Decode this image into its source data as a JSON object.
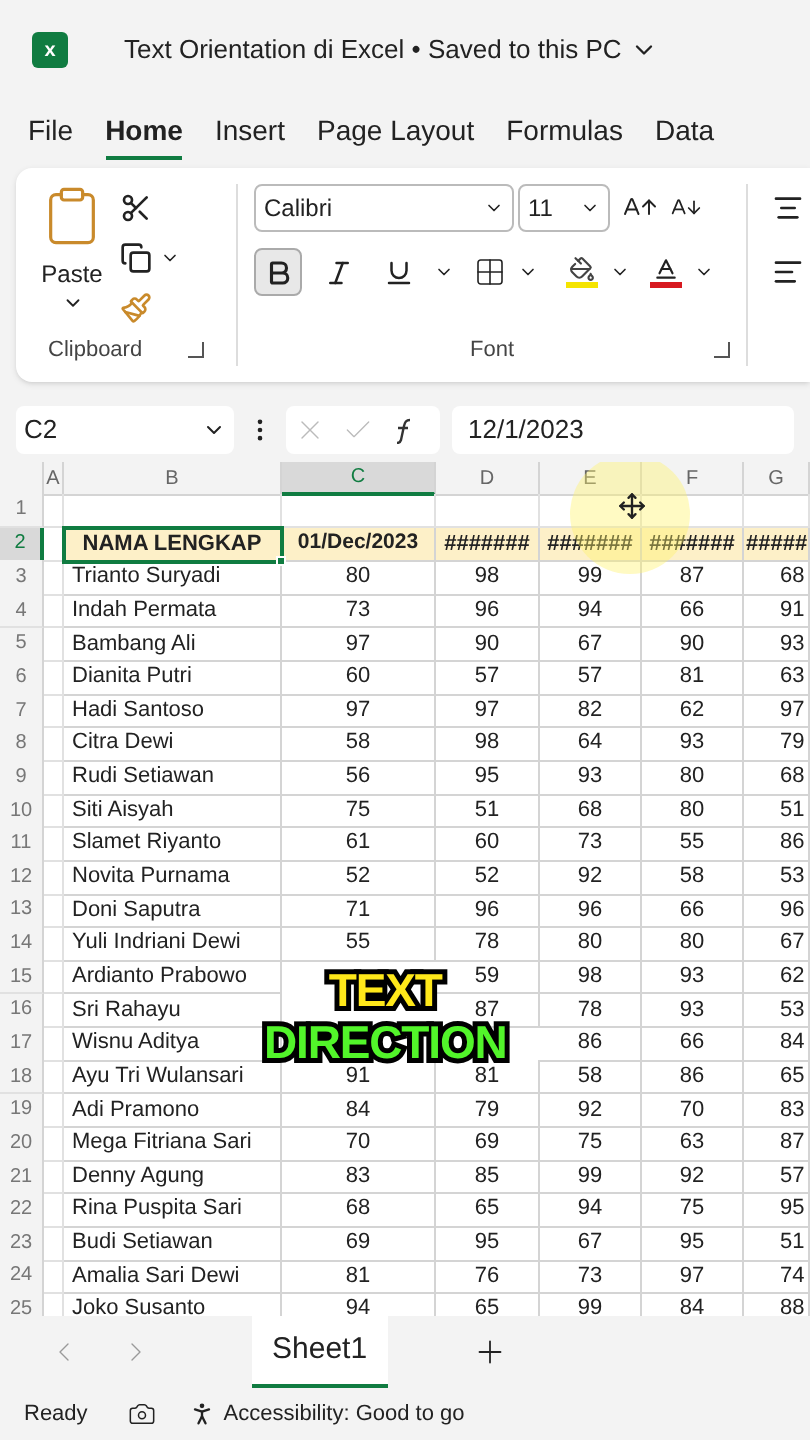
{
  "title_bar": {
    "logo_letter": "x",
    "title": "Text Orientation di Excel • Saved to this PC"
  },
  "tabs": [
    {
      "label": "File",
      "selected": false
    },
    {
      "label": "Home",
      "selected": true
    },
    {
      "label": "Insert",
      "selected": false
    },
    {
      "label": "Page Layout",
      "selected": false
    },
    {
      "label": "Formulas",
      "selected": false
    },
    {
      "label": "Data",
      "selected": false
    }
  ],
  "ribbon": {
    "clipboard": {
      "paste_label": "Paste",
      "group_label": "Clipboard"
    },
    "font": {
      "font_name": "Calibri",
      "font_size": "11",
      "group_label": "Font",
      "style_buttons": [
        {
          "kind": "bold",
          "selected": true
        },
        {
          "kind": "italic",
          "selected": false
        },
        {
          "kind": "underline",
          "selected": false
        }
      ]
    }
  },
  "formula_bar": {
    "name_box": "C2",
    "formula": "12/1/2023"
  },
  "sheet": {
    "columns": [
      {
        "label": "A",
        "selected": false
      },
      {
        "label": "B",
        "selected": false
      },
      {
        "label": "C",
        "selected": true
      },
      {
        "label": "D",
        "selected": false
      },
      {
        "label": "E",
        "selected": false
      },
      {
        "label": "F",
        "selected": false
      },
      {
        "label": "G",
        "selected": false
      }
    ],
    "rows": [
      {
        "number": "1",
        "selected": false,
        "kind": "empty"
      },
      {
        "number": "2",
        "selected": true,
        "kind": "header",
        "cells": [
          "NAMA LENGKAP",
          "01/Dec/2023",
          "#######",
          "#######",
          "#######",
          "#####"
        ]
      },
      {
        "number": "3",
        "selected": false,
        "kind": "data",
        "cells": [
          "Trianto Suryadi",
          "80",
          "98",
          "99",
          "87",
          "68"
        ]
      },
      {
        "number": "4",
        "selected": false,
        "kind": "data",
        "cells": [
          "Indah Permata",
          "73",
          "96",
          "94",
          "66",
          "91"
        ]
      },
      {
        "number": "5",
        "selected": false,
        "kind": "data",
        "cells": [
          "Bambang Ali",
          "97",
          "90",
          "67",
          "90",
          "93"
        ]
      },
      {
        "number": "6",
        "selected": false,
        "kind": "data",
        "cells": [
          "Dianita Putri",
          "60",
          "57",
          "57",
          "81",
          "63"
        ]
      },
      {
        "number": "7",
        "selected": false,
        "kind": "data",
        "cells": [
          "Hadi Santoso",
          "97",
          "97",
          "82",
          "62",
          "97"
        ]
      },
      {
        "number": "8",
        "selected": false,
        "kind": "data",
        "cells": [
          "Citra Dewi",
          "58",
          "98",
          "64",
          "93",
          "79"
        ]
      },
      {
        "number": "9",
        "selected": false,
        "kind": "data",
        "cells": [
          "Rudi Setiawan",
          "56",
          "95",
          "93",
          "80",
          "68"
        ]
      },
      {
        "number": "10",
        "selected": false,
        "kind": "data",
        "cells": [
          "Siti Aisyah",
          "75",
          "51",
          "68",
          "80",
          "51"
        ]
      },
      {
        "number": "11",
        "selected": false,
        "kind": "data",
        "cells": [
          "Slamet Riyanto",
          "61",
          "60",
          "73",
          "55",
          "86"
        ]
      },
      {
        "number": "12",
        "selected": false,
        "kind": "data",
        "cells": [
          "Novita Purnama",
          "52",
          "52",
          "92",
          "58",
          "53"
        ]
      },
      {
        "number": "13",
        "selected": false,
        "kind": "data",
        "cells": [
          "Doni Saputra",
          "71",
          "96",
          "96",
          "66",
          "96"
        ]
      },
      {
        "number": "14",
        "selected": false,
        "kind": "data",
        "cells": [
          "Yuli Indriani Dewi",
          "55",
          "78",
          "80",
          "80",
          "67"
        ]
      },
      {
        "number": "15",
        "selected": false,
        "kind": "data",
        "cells": [
          "Ardianto Prabowo",
          null,
          "59",
          "98",
          "93",
          "62"
        ]
      },
      {
        "number": "16",
        "selected": false,
        "kind": "data",
        "cells": [
          "Sri Rahayu",
          null,
          "87",
          "78",
          "93",
          "53"
        ]
      },
      {
        "number": "17",
        "selected": false,
        "kind": "data",
        "cells": [
          "Wisnu Aditya",
          null,
          null,
          "86",
          "66",
          "84"
        ]
      },
      {
        "number": "18",
        "selected": false,
        "kind": "data",
        "cells": [
          "Ayu Tri Wulansari",
          "91",
          "81",
          "58",
          "86",
          "65"
        ]
      },
      {
        "number": "19",
        "selected": false,
        "kind": "data",
        "cells": [
          "Adi Pramono",
          "84",
          "79",
          "92",
          "70",
          "83"
        ]
      },
      {
        "number": "20",
        "selected": false,
        "kind": "data",
        "cells": [
          "Mega Fitriana Sari",
          "70",
          "69",
          "75",
          "63",
          "87"
        ]
      },
      {
        "number": "21",
        "selected": false,
        "kind": "data",
        "cells": [
          "Denny Agung",
          "83",
          "85",
          "99",
          "92",
          "57"
        ]
      },
      {
        "number": "22",
        "selected": false,
        "kind": "data",
        "cells": [
          "Rina Puspita Sari",
          "68",
          "65",
          "94",
          "75",
          "95"
        ]
      },
      {
        "number": "23",
        "selected": false,
        "kind": "data",
        "cells": [
          "Budi Setiawan",
          "69",
          "95",
          "67",
          "95",
          "51"
        ]
      },
      {
        "number": "24",
        "selected": false,
        "kind": "data",
        "cells": [
          "Amalia Sari Dewi",
          "81",
          "76",
          "73",
          "97",
          "74"
        ]
      },
      {
        "number": "25",
        "selected": false,
        "kind": "data",
        "cells": [
          "Joko Susanto",
          "94",
          "65",
          "99",
          "84",
          "88"
        ]
      }
    ]
  },
  "caption": [
    {
      "text": "TEXT",
      "color": "#ffe81a"
    },
    {
      "text": "DIRECTION",
      "color": "#52f52a"
    }
  ],
  "sheet_tabs": [
    {
      "label": "Sheet1",
      "selected": true
    }
  ],
  "status_bar": {
    "status": "Ready",
    "accessibility": "Accessibility: Good to go"
  }
}
